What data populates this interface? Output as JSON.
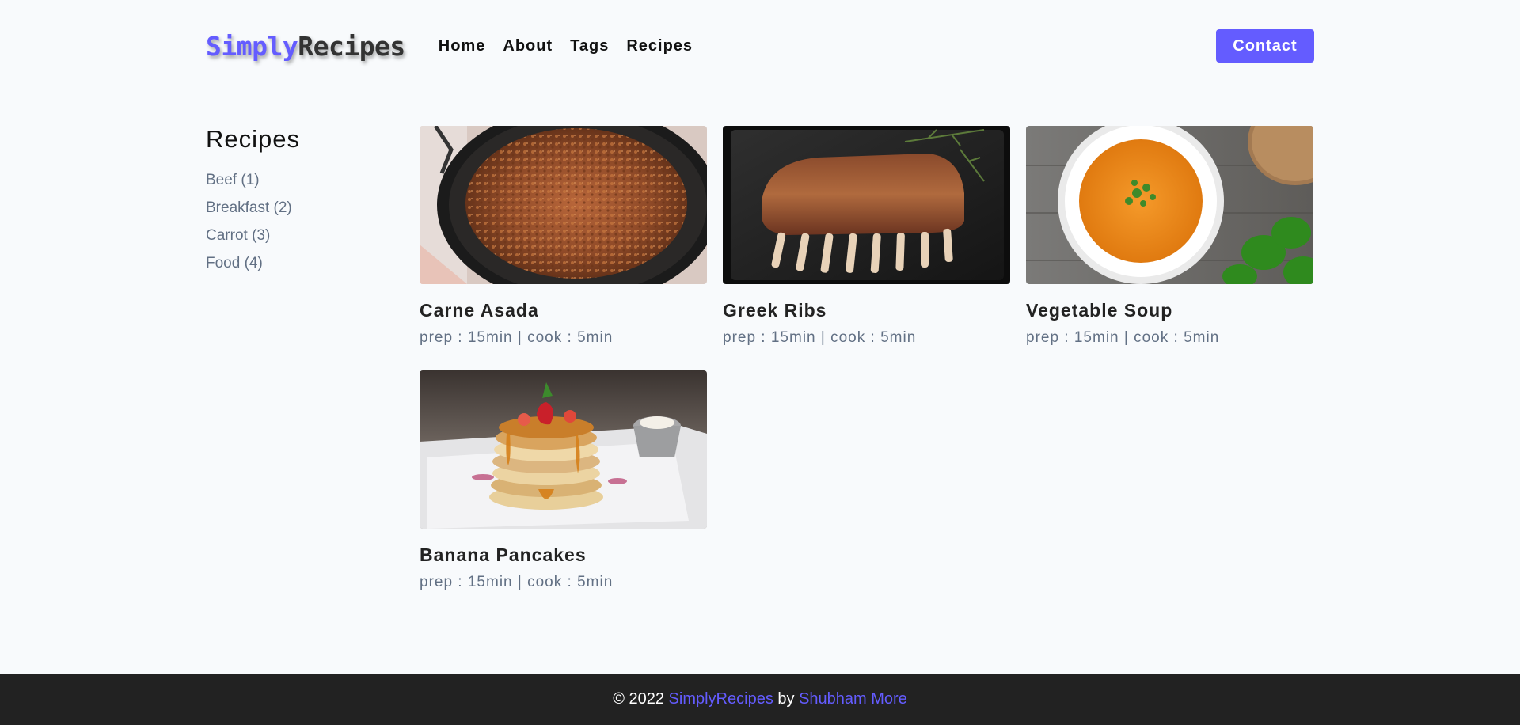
{
  "header": {
    "logo_part1": "Simply",
    "logo_part2": "Recipes",
    "nav": [
      "Home",
      "About",
      "Tags",
      "Recipes"
    ],
    "contact_label": "Contact"
  },
  "sidebar": {
    "title": "Recipes",
    "tags": [
      "Beef (1)",
      "Breakfast (2)",
      "Carrot (3)",
      "Food (4)"
    ]
  },
  "recipes": [
    {
      "title": "Carne Asada",
      "meta": "prep : 15min | cook : 5min",
      "image": "carne-asada-photo"
    },
    {
      "title": "Greek Ribs",
      "meta": "prep : 15min | cook : 5min",
      "image": "greek-ribs-photo"
    },
    {
      "title": "Vegetable Soup",
      "meta": "prep : 15min | cook : 5min",
      "image": "vegetable-soup-photo"
    },
    {
      "title": "Banana Pancakes",
      "meta": "prep : 15min | cook : 5min",
      "image": "banana-pancakes-photo"
    }
  ],
  "footer": {
    "copyright": "© 2022",
    "brand": "SimplyRecipes",
    "by": "by",
    "author": "Shubham More"
  },
  "colors": {
    "accent": "#645cff",
    "footer_bg": "#222222",
    "muted_text": "#627084"
  }
}
